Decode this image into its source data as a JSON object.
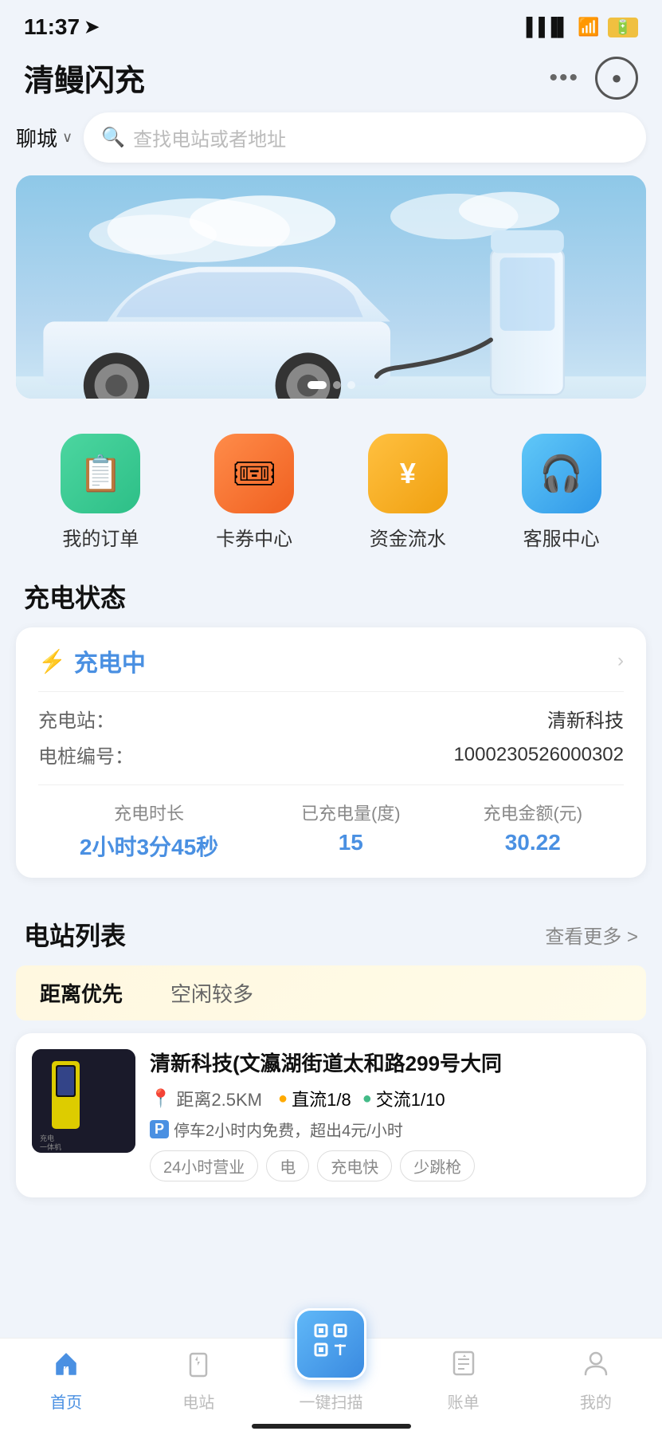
{
  "statusBar": {
    "time": "11:37",
    "locationArrow": "➤"
  },
  "header": {
    "title": "清鳗闪充",
    "dotsLabel": "•••",
    "scanLabel": "⊙"
  },
  "search": {
    "city": "聊城",
    "placeholder": "查找电站或者地址"
  },
  "banner": {
    "dots": [
      true,
      false,
      false
    ]
  },
  "quickMenu": {
    "items": [
      {
        "id": "orders",
        "icon": "📋",
        "label": "我的订单",
        "colorClass": "green"
      },
      {
        "id": "cards",
        "icon": "🎟",
        "label": "卡券中心",
        "colorClass": "orange"
      },
      {
        "id": "funds",
        "icon": "¥",
        "label": "资金流水",
        "colorClass": "yellow"
      },
      {
        "id": "service",
        "icon": "🎧",
        "label": "客服中心",
        "colorClass": "blue"
      }
    ]
  },
  "chargingStatus": {
    "sectionTitle": "充电状态",
    "statusLabel": "充电中",
    "arrowLabel": ">",
    "stationLabel": "充电站：",
    "stationName": "清新科技",
    "pileLabel": "电桩编号：",
    "pileNo": "1000230526000302",
    "stats": [
      {
        "label": "充电时长",
        "value": "2小时3分45秒"
      },
      {
        "label": "已充电量(度)",
        "value": "15"
      },
      {
        "label": "充电金额(元)",
        "value": "30.22"
      }
    ]
  },
  "stationList": {
    "sectionTitle": "电站列表",
    "moreLabel": "查看更多 >",
    "filterTabs": [
      "距离优先",
      "空闲较多"
    ],
    "activeTab": 0,
    "stations": [
      {
        "name": "清新科技(文瀛湖街道太和路299号大同",
        "distance": "距离2.5KM",
        "dc": "直流1/8",
        "ac": "交流1/10",
        "parking": "停车2小时内免费，超出4元/小时",
        "tags": [
          "24小时营业",
          "电",
          "充电快",
          "少跳枪"
        ]
      }
    ]
  },
  "bottomNav": {
    "items": [
      {
        "id": "home",
        "icon": "⚡",
        "label": "首页",
        "active": true
      },
      {
        "id": "stations",
        "icon": "🔌",
        "label": "电站",
        "active": false
      },
      {
        "id": "scan",
        "icon": "⬛",
        "label": "一键扫描",
        "active": false,
        "isCenter": true
      },
      {
        "id": "bills",
        "icon": "📄",
        "label": "账单",
        "active": false
      },
      {
        "id": "mine",
        "icon": "👤",
        "label": "我的",
        "active": false
      }
    ]
  }
}
